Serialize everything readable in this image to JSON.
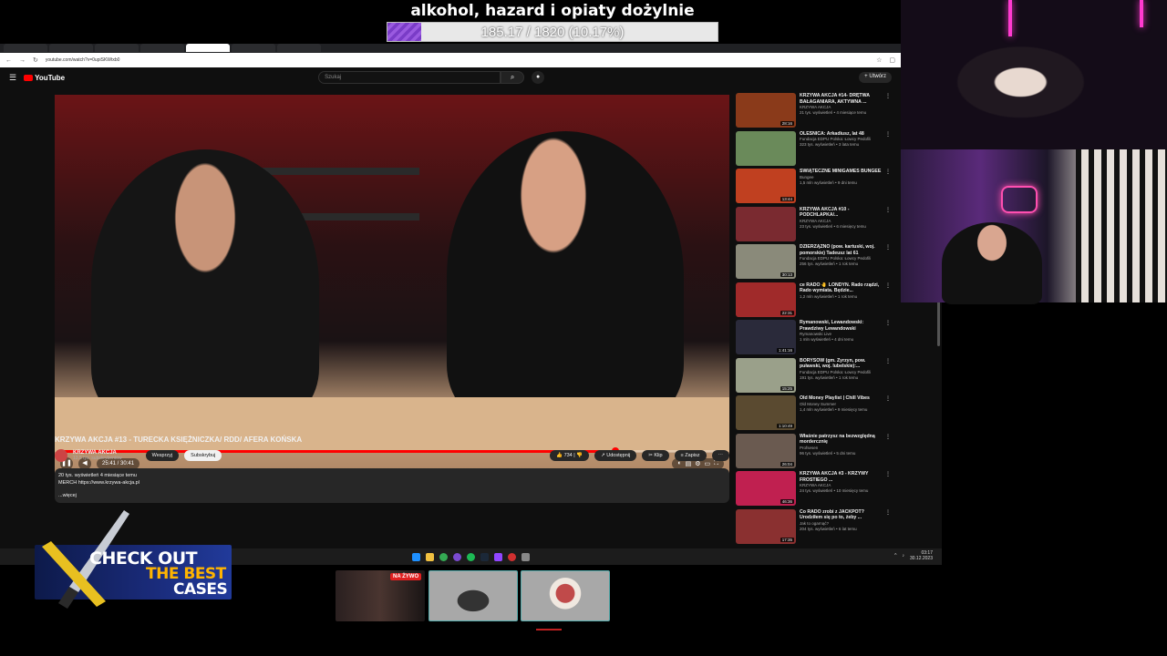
{
  "overlay": {
    "goal_title": "alkohol, hazard i opiaty dożylnie",
    "goal_progress_text": "185.17 / 1820 (10.17%)",
    "goal_fraction": 0.1017
  },
  "browser": {
    "url": "youtube.com/watch?v=0upiSKWtxb0",
    "tabs": [
      "",
      "",
      "",
      "",
      "",
      "",
      ""
    ]
  },
  "youtube": {
    "logo": "YouTube",
    "search_placeholder": "Szukaj",
    "create_label": "Utwórz",
    "player": {
      "time": "25:41 / 30:41",
      "progress_fraction": 0.837
    },
    "video_title": "KRZYWA AKCJA #13 - TURECKA KSIĘŻNICZKA/ RDD/ AFERA KOŃSKA",
    "channel_name": "KRZYWA AKCJA",
    "channel_subs": "13,5 tys. subskrybentów",
    "support_label": "Wesprzyj",
    "subscribe_label": "Subskrybuj",
    "like_count": "734",
    "share_label": "Udostępnij",
    "clip_label": "Klip",
    "save_label": "Zapisz",
    "description": {
      "stats": "20 tys. wyświetleń  4 miesiące temu",
      "merch": "MERCH https://www.krzywa-akcja.pl",
      "more": "...więcej"
    },
    "recommendations": [
      {
        "title": "KRZYWA AKCJA #14- DRĘTWA BAŁAGANIARA, AKTYWNA ...",
        "channel": "KRZYWA AKCJA",
        "meta": "21 tys. wyświetleń • 4 miesiące temu",
        "duration": "28:16",
        "color": "#8a3a1a"
      },
      {
        "title": "OLEŚNICA: Arkadiusz, lat 48",
        "channel": "Fundacja EDPU Polska: Łowcy Pedofili",
        "meta": "323 tys. wyświetleń • 3 lata temu",
        "duration": "",
        "color": "#6a8a5a"
      },
      {
        "title": "ŚWIĄTECZNE MINIGAMES BUNGEE",
        "channel": "Bungee",
        "meta": "1,5 mln wyświetleń • 9 dni temu",
        "duration": "13:44",
        "color": "#c04020"
      },
      {
        "title": "KRZYWA AKCJA #10 - PODCHLAPKA/...",
        "channel": "KRZYWA AKCJA",
        "meta": "23 tys. wyświetleń • 6 miesięcy temu",
        "duration": "",
        "color": "#7a2a30"
      },
      {
        "title": "DZIERŻĄŻNO (pow. kartuski, woj. pomorskie) Tadeusz lat 61",
        "channel": "Fundacja EDPU Polska: Łowcy Pedofili",
        "meta": "256 tys. wyświetleń • 1 rok temu",
        "duration": "30:13",
        "color": "#8a8a7a"
      },
      {
        "title": "ce RADO 🤚 LONDYN. Rado rządzi, Rado wymiata. Będzie...",
        "channel": "",
        "meta": "1,2 mln wyświetleń • 1 rok temu",
        "duration": "22:31",
        "color": "#a02a2a"
      },
      {
        "title": "Rymanowski, Lewandowski: Prawdziwy Lewandowski",
        "channel": "Rymanowski Live",
        "meta": "1 mln wyświetleń • 4 dni temu",
        "duration": "1:41:16",
        "color": "#2a2a3a"
      },
      {
        "title": "BORYSÓW (gm. Żyrzyn, pow. puławski, woj. lubelskie):...",
        "channel": "Fundacja EDPU Polska: Łowcy Pedofili",
        "meta": "191 tys. wyświetleń • 1 rok temu",
        "duration": "15:25",
        "color": "#9aa08a"
      },
      {
        "title": "Old Money Playlist | Chill Vibes",
        "channel": "Old Money Summer",
        "meta": "1,4 mln wyświetleń • 9 miesięcy temu",
        "duration": "1:10:49",
        "color": "#5a4a30"
      },
      {
        "title": "Właśnie patrzysz na bezwzględną mordercznię",
        "channel": "Profsesen",
        "meta": "96 tys. wyświetleń • 5 dni temu",
        "duration": "26:04",
        "color": "#6a5a50"
      },
      {
        "title": "KRZYWA AKCJA #3 - KRZYWY FROSTIEGO ...",
        "channel": "KRZYWA AKCJA",
        "meta": "24 tys. wyświetleń • 10 miesięcy temu",
        "duration": "46:36",
        "color": "#c02050"
      },
      {
        "title": "Co RADO zrobi z JACKPOT? Urodziłem się po to, żeby ...",
        "channel": "Jak to ogarnąć?",
        "meta": "204 tys. wyświetleń • 6 lat temu",
        "duration": "17:35",
        "color": "#8a3030"
      }
    ]
  },
  "taskbar": {
    "time": "03:17",
    "date": "30.12.2023"
  },
  "banner": {
    "line1": "CHECK OUT",
    "line2": "THE BEST",
    "line3": "CASES"
  },
  "thumbs": {
    "live_badge": "NA ŻYWO"
  }
}
